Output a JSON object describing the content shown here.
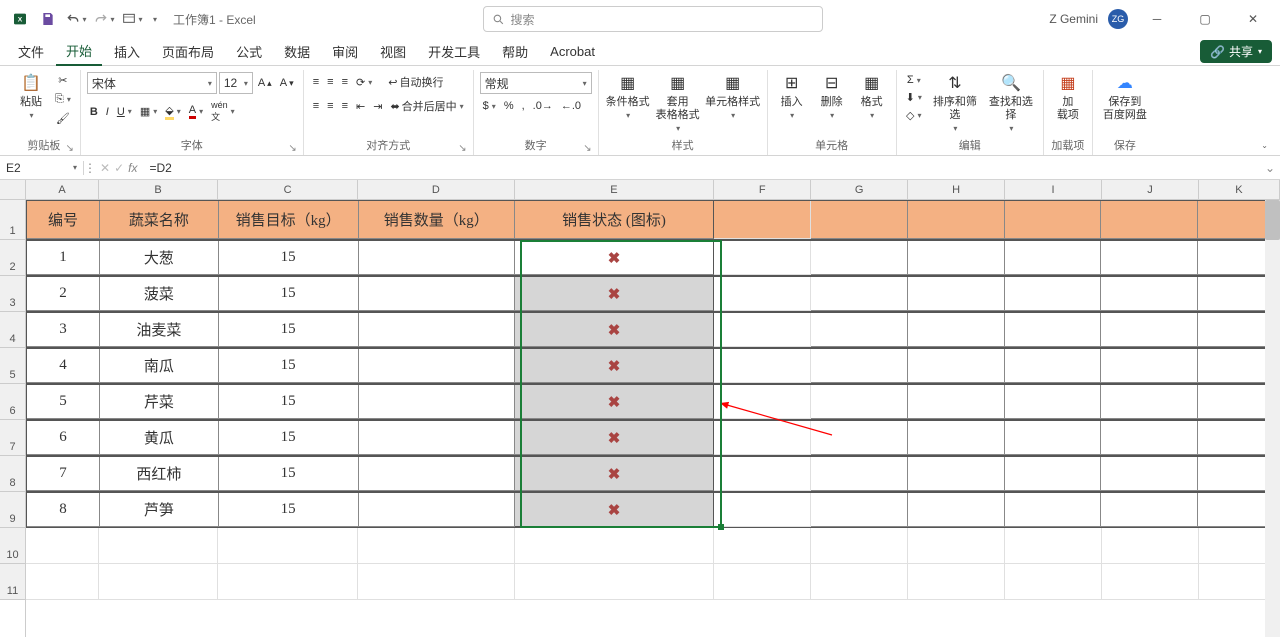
{
  "titlebar": {
    "title": "工作簿1 - Excel",
    "search_placeholder": "搜索",
    "user_name": "Z Gemini",
    "user_initials": "ZG"
  },
  "tabs": {
    "items": [
      "文件",
      "开始",
      "插入",
      "页面布局",
      "公式",
      "数据",
      "审阅",
      "视图",
      "开发工具",
      "帮助",
      "Acrobat"
    ],
    "active_index": 1,
    "share_label": "共享"
  },
  "ribbon": {
    "clipboard": {
      "paste": "粘贴",
      "label": "剪贴板"
    },
    "font": {
      "name": "宋体",
      "size": "12",
      "label": "字体"
    },
    "alignment": {
      "wrap": "自动换行",
      "merge": "合并后居中",
      "label": "对齐方式"
    },
    "number": {
      "format": "常规",
      "label": "数字"
    },
    "styles": {
      "cond": "条件格式",
      "table": "套用\n表格格式",
      "cell": "单元格样式",
      "label": "样式"
    },
    "cells": {
      "insert": "插入",
      "delete": "删除",
      "format": "格式",
      "label": "单元格"
    },
    "editing": {
      "sort": "排序和筛选",
      "find": "查找和选择",
      "label": "编辑"
    },
    "addins": {
      "btn": "加\n载项",
      "label": "加载项"
    },
    "save": {
      "btn": "保存到\n百度网盘",
      "label": "保存"
    }
  },
  "formula_bar": {
    "cell_ref": "E2",
    "formula": "=D2"
  },
  "grid": {
    "columns": [
      "A",
      "B",
      "C",
      "D",
      "E",
      "F",
      "G",
      "H",
      "I",
      "J",
      "K"
    ],
    "row_numbers": [
      "1",
      "2",
      "3",
      "4",
      "5",
      "6",
      "7",
      "8",
      "9",
      "10",
      "11"
    ],
    "headers": [
      "编号",
      "蔬菜名称",
      "销售目标（kg）",
      "销售数量（kg）",
      "销售状态 (图标)"
    ],
    "rows": [
      {
        "id": "1",
        "name": "大葱",
        "target": "15",
        "qty": "",
        "status": "x"
      },
      {
        "id": "2",
        "name": "菠菜",
        "target": "15",
        "qty": "",
        "status": "x"
      },
      {
        "id": "3",
        "name": "油麦菜",
        "target": "15",
        "qty": "",
        "status": "x"
      },
      {
        "id": "4",
        "name": "南瓜",
        "target": "15",
        "qty": "",
        "status": "x"
      },
      {
        "id": "5",
        "name": "芹菜",
        "target": "15",
        "qty": "",
        "status": "x"
      },
      {
        "id": "6",
        "name": "黄瓜",
        "target": "15",
        "qty": "",
        "status": "x"
      },
      {
        "id": "7",
        "name": "西红柿",
        "target": "15",
        "qty": "",
        "status": "x"
      },
      {
        "id": "8",
        "name": "芦笋",
        "target": "15",
        "qty": "",
        "status": "x"
      }
    ],
    "selected_range": "E2:E9",
    "active_cell": "E2"
  },
  "colors": {
    "excel_green": "#185c37",
    "header_fill": "#f4b183",
    "x_icon": "#a94442",
    "selection_fill": "#d6d6d6",
    "arrow": "#ff0000"
  }
}
